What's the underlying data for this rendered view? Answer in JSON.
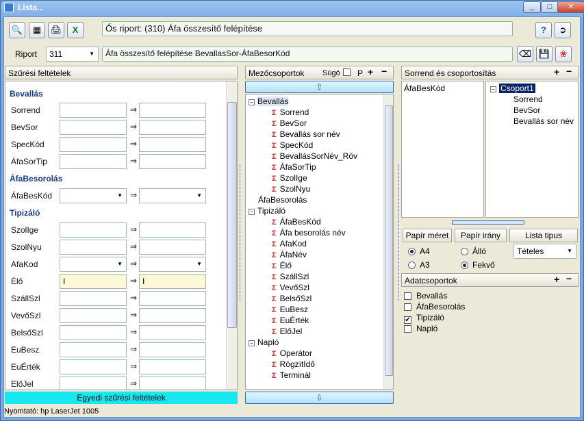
{
  "window": {
    "title": "Lista...",
    "min": "_",
    "max": "□",
    "close": "✕"
  },
  "toolbar": {
    "report_caption": "Ős riport: (310)  Áfa összesítő felépítése"
  },
  "riport": {
    "label": "Riport",
    "value": "311",
    "description": "Áfa összesítő felépítése BevallasSor-ÁfaBesorKód"
  },
  "filters": {
    "title": "Szűrési feltételek",
    "arrow": "⇒",
    "footer_button": "Egyedi szűrési feltételek",
    "sections": [
      {
        "title": "Bevallás"
      },
      {
        "title": "ÁfaBesorolás"
      },
      {
        "title": "Tipizáló"
      }
    ],
    "rows": [
      {
        "label": "Sorrend",
        "from": "",
        "to": ""
      },
      {
        "label": "BevSor",
        "from": "",
        "to": ""
      },
      {
        "label": "SpecKód",
        "from": "",
        "to": ""
      },
      {
        "label": "ÁfaSorTip",
        "from": "",
        "to": ""
      },
      {
        "label": "ÁfaBesKód",
        "from": "",
        "to": ""
      },
      {
        "label": "SzolIge",
        "from": "",
        "to": ""
      },
      {
        "label": "SzolNyu",
        "from": "",
        "to": ""
      },
      {
        "label": "AfaKod",
        "from": "",
        "to": ""
      },
      {
        "label": "Élő",
        "from": "I",
        "to": "I"
      },
      {
        "label": "SzállSzl",
        "from": "",
        "to": ""
      },
      {
        "label": "VevőSzl",
        "from": "",
        "to": ""
      },
      {
        "label": "BelsőSzl",
        "from": "",
        "to": ""
      },
      {
        "label": "EuBesz",
        "from": "",
        "to": ""
      },
      {
        "label": "EuÉrték",
        "from": "",
        "to": ""
      },
      {
        "label": "ElőJel",
        "from": "",
        "to": ""
      }
    ]
  },
  "fieldgroups": {
    "title": "Mezőcsoportok",
    "help": "Súgó",
    "p": "P",
    "tree": [
      {
        "label": "Bevallás",
        "children": [
          "Sorrend",
          "BevSor",
          "Bevallás sor név",
          "SpecKód",
          "BevallásSorNév_Röv",
          "ÁfaSorTip",
          "SzolIge",
          "SzolNyu"
        ]
      },
      {
        "label": "ÁfaBesorolás",
        "children": []
      },
      {
        "label": "Tipizáló",
        "children": [
          "ÁfaBesKód",
          "Áfa besorolás név",
          "AfaKod",
          "ÁfaNév",
          "Élő",
          "SzállSzl",
          "VevőSzl",
          "BelsőSzl",
          "EuBesz",
          "EuÉrték",
          "ElőJel"
        ]
      },
      {
        "label": "Napló",
        "children": [
          "Operátor",
          "RögzítIdő",
          "Terminál"
        ]
      }
    ]
  },
  "order": {
    "title": "Sorrend és csoportosítás",
    "left_item": "ÁfaBesKód",
    "group": "Csoport1",
    "group_items": [
      "Sorrend",
      "BevSor",
      "Bevallás sor név"
    ]
  },
  "print": {
    "paper_size": "Papír méret",
    "paper_orient": "Papír irány",
    "list_type": "Lista tipus",
    "a4": "A4",
    "a3": "A3",
    "allo": "Álló",
    "fekvo": "Fekvő",
    "list_type_value": "Tételes"
  },
  "datagroups": {
    "title": "Adatcsoportok",
    "items": [
      {
        "label": "Bevallás",
        "checked": false
      },
      {
        "label": "ÁfaBesorolás",
        "checked": false
      },
      {
        "label": "Tipizáló",
        "checked": true
      },
      {
        "label": "Napló",
        "checked": false
      }
    ]
  },
  "status": {
    "printer": "Nyomtató: hp LaserJet 1005"
  }
}
